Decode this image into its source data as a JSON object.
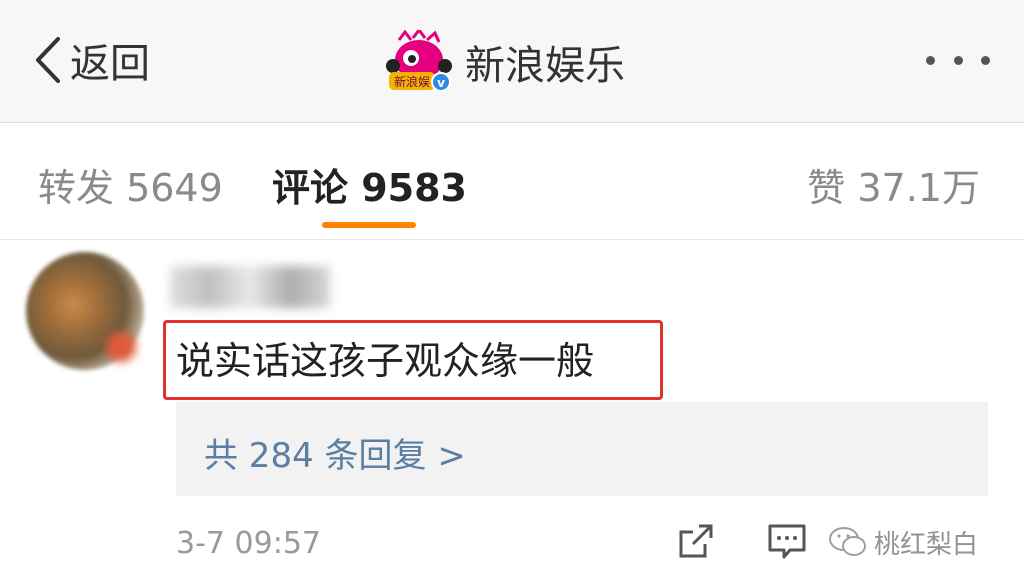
{
  "header": {
    "back_label": "返回",
    "title": "新浪娱乐",
    "logo_text": "新浪娱",
    "verified_badge": "v",
    "brand_color": "#e4007f"
  },
  "tabs": {
    "repost": "转发 5649",
    "comments": "评论 9583",
    "likes": "赞 37.1万",
    "active_color": "#ff8200"
  },
  "comment": {
    "text": "说实话这孩子观众缘一般",
    "replies_label": "共 284 条回复 >",
    "time": "3-7 09:57",
    "highlight_color": "#e03030"
  },
  "watermark": {
    "text": "桃红梨白"
  }
}
